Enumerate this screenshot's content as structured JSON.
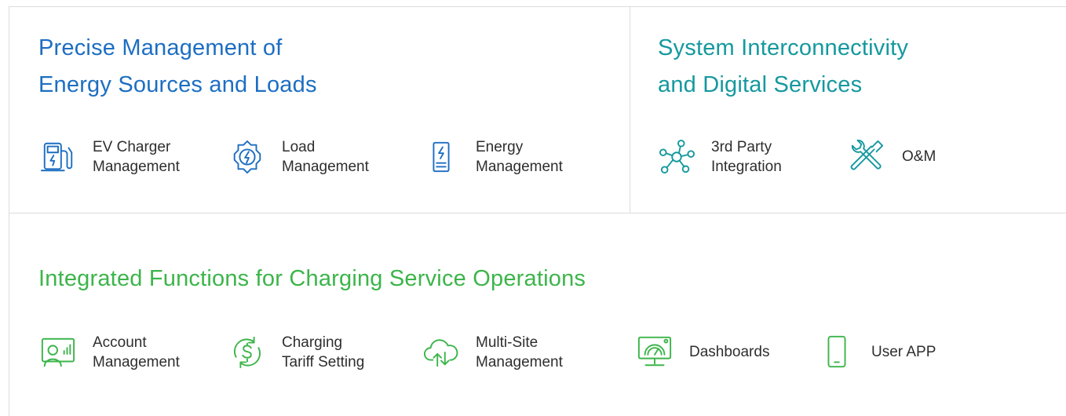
{
  "colors": {
    "blue": "#1d6ec2",
    "teal": "#15999f",
    "green": "#3cb54a",
    "border": "#dcdcdc"
  },
  "sections": {
    "energy": {
      "title_line1": "Precise Management of",
      "title_line2": "Energy Sources and Loads",
      "items": [
        {
          "icon": "ev-charger-icon",
          "line1": "EV Charger",
          "line2": "Management"
        },
        {
          "icon": "load-gear-icon",
          "line1": "Load",
          "line2": "Management"
        },
        {
          "icon": "battery-bolt-icon",
          "line1": "Energy",
          "line2": "Management"
        }
      ]
    },
    "system": {
      "title_line1": "System Interconnectivity",
      "title_line2": "and Digital Services",
      "items": [
        {
          "icon": "network-nodes-icon",
          "line1": "3rd Party",
          "line2": "Integration"
        },
        {
          "icon": "tools-icon",
          "line1": "O&M",
          "line2": ""
        }
      ]
    },
    "operations": {
      "title": "Integrated Functions for Charging Service Operations",
      "items": [
        {
          "icon": "account-chart-icon",
          "line1": "Account",
          "line2": "Management"
        },
        {
          "icon": "tariff-cycle-icon",
          "line1": "Charging",
          "line2": "Tariff Setting"
        },
        {
          "icon": "cloud-sync-icon",
          "line1": "Multi-Site",
          "line2": "Management"
        },
        {
          "icon": "dashboard-monitor-icon",
          "line1": "Dashboards",
          "line2": ""
        },
        {
          "icon": "smartphone-icon",
          "line1": "User APP",
          "line2": ""
        }
      ]
    }
  }
}
